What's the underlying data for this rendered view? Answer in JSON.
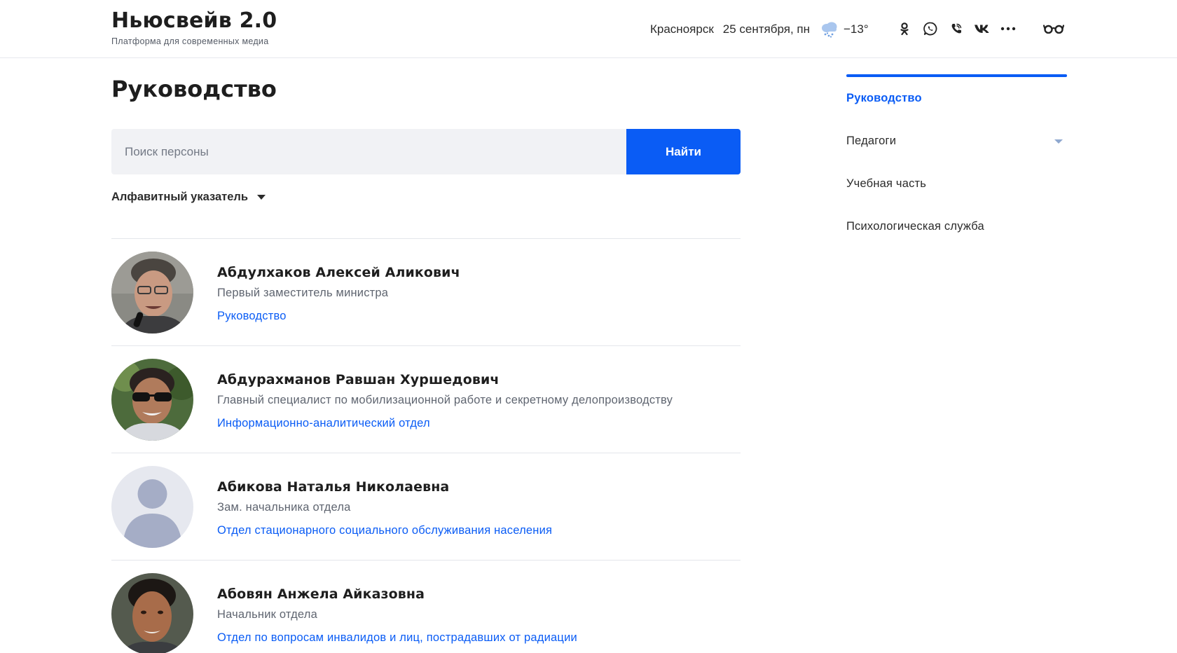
{
  "header": {
    "title": "Ньюсвейв 2.0",
    "subtitle": "Платформа для современных медиа",
    "city": "Красноярск",
    "date": "25 сентября, пн",
    "weather_icon": "snow-cloud-icon",
    "temperature": "−13°",
    "social_icons": [
      "odnoklassniki-icon",
      "whatsapp-icon",
      "viber-icon",
      "vk-icon",
      "more-icon"
    ],
    "accessibility_icon": "glasses-icon"
  },
  "main": {
    "title": "Руководство",
    "search": {
      "placeholder": "Поиск персоны",
      "value": "",
      "button_label": "Найти"
    },
    "alphabet_index_label": "Алфавитный указатель"
  },
  "people": [
    {
      "name": "Абдулхаков Алексей Аликович",
      "position": "Первый заместитель министра",
      "department": "Руководство",
      "avatar": "photo"
    },
    {
      "name": "Абдурахманов Равшан Хуршедович",
      "position": "Главный специалист по мобилизационной работе и секретному делопроизводству",
      "department": "Информационно-аналитический отдел",
      "avatar": "photo"
    },
    {
      "name": "Абикова Наталья Николаевна",
      "position": "Зам. начальника отдела",
      "department": "Отдел стационарного социального обслуживания населения",
      "avatar": "placeholder"
    },
    {
      "name": "Абовян Анжела Айказовна",
      "position": "Начальник отдела",
      "department": "Отдел по вопросам инвалидов и лиц, пострадавших от радиации",
      "avatar": "photo"
    }
  ],
  "sidebar": {
    "items": [
      {
        "label": "Руководство",
        "active": true
      },
      {
        "label": "Педагоги",
        "has_dropdown": true
      },
      {
        "label": "Учебная часть"
      },
      {
        "label": "Психологическая служба"
      }
    ]
  },
  "colors": {
    "accent": "#0a5cf5",
    "search_bg": "#f1f2f5",
    "divider": "#e4e6eb"
  }
}
